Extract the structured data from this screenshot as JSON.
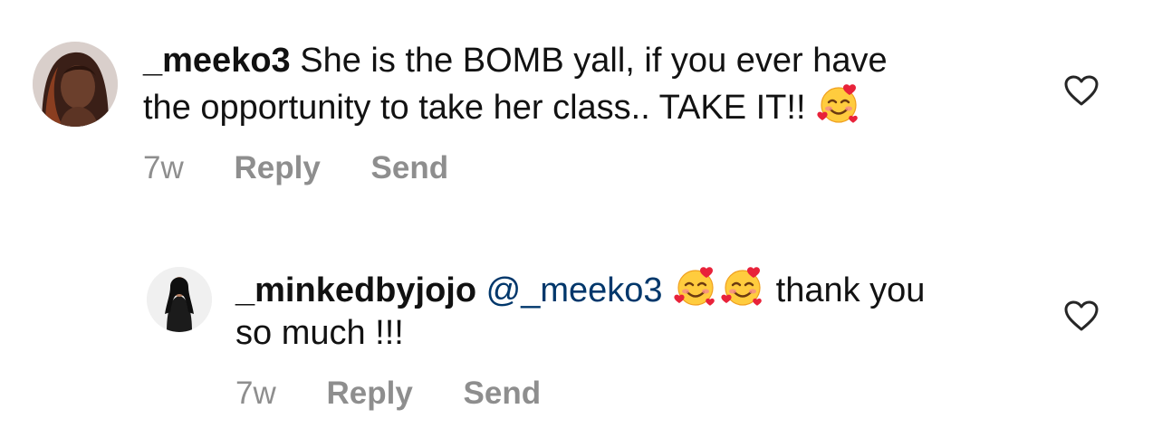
{
  "comments": [
    {
      "username": "_meeko3",
      "text_line1": " She is the BOMB yall, if you ever have",
      "text_line2": "the opportunity to take her class.. TAKE IT!!",
      "time": "7w",
      "reply_label": "Reply",
      "send_label": "Send",
      "emoji": "smiling-face-with-hearts",
      "like_icon": "heart-outline-icon"
    },
    {
      "username": "_minkedbyjojo",
      "mention": "@_meeko3",
      "text_after_emoji": "thank you",
      "text_line2": "so much !!!",
      "time": "7w",
      "reply_label": "Reply",
      "send_label": "Send",
      "emoji": "smiling-face-with-hearts",
      "like_icon": "heart-outline-icon"
    }
  ]
}
